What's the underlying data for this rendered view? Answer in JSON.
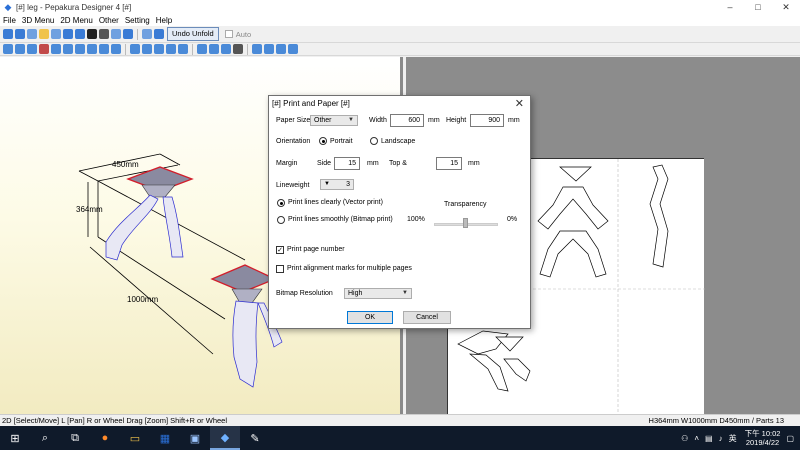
{
  "window": {
    "title": "[#] leg - Pepakura Designer 4 [#]",
    "minimize": "–",
    "maximize": "□",
    "close": "✕"
  },
  "menu": [
    "File",
    "3D Menu",
    "2D Menu",
    "Other",
    "Setting",
    "Help"
  ],
  "toolbar": {
    "undo_unfold": "Undo Unfold",
    "auto_label": "Auto"
  },
  "view3d": {
    "dim_width": "450mm",
    "dim_height": "364mm",
    "dim_depth": "1000mm"
  },
  "dialog": {
    "title": "[#] Print and Paper [#]",
    "paper_size_label": "Paper Size",
    "paper_size_value": "Other",
    "width_label": "Width",
    "width_value": "600",
    "width_unit": "mm",
    "height_label": "Height",
    "height_value": "900",
    "height_unit": "mm",
    "orientation_label": "Orientation",
    "portrait": "Portrait",
    "landscape": "Landscape",
    "margin_label": "Margin",
    "side_label": "Side",
    "side_value": "15",
    "side_unit": "mm",
    "top_label": "Top &",
    "top_value": "15",
    "top_unit": "mm",
    "lineweight_label": "Lineweight",
    "lineweight_value": "3",
    "vector_print": "Print lines clearly (Vector print)",
    "bitmap_print": "Print lines smoothly (Bitmap print)",
    "transparency_label": "Transparency",
    "transparency_max": "100%",
    "transparency_min": "0%",
    "print_page_number": "Print page number",
    "print_alignment": "Print alignment marks for multiple pages",
    "bitmap_resolution_label": "Bitmap Resolution",
    "bitmap_resolution_value": "High",
    "ok": "OK",
    "cancel": "Cancel"
  },
  "status": {
    "left": "2D [Select/Move] L [Pan] R or Wheel Drag [Zoom] Shift+R or Wheel",
    "right": "H364mm W1000mm D450mm / Parts 13"
  },
  "taskbar": {
    "ime": "英",
    "time": "下午 10:02",
    "date": "2019/4/22"
  }
}
